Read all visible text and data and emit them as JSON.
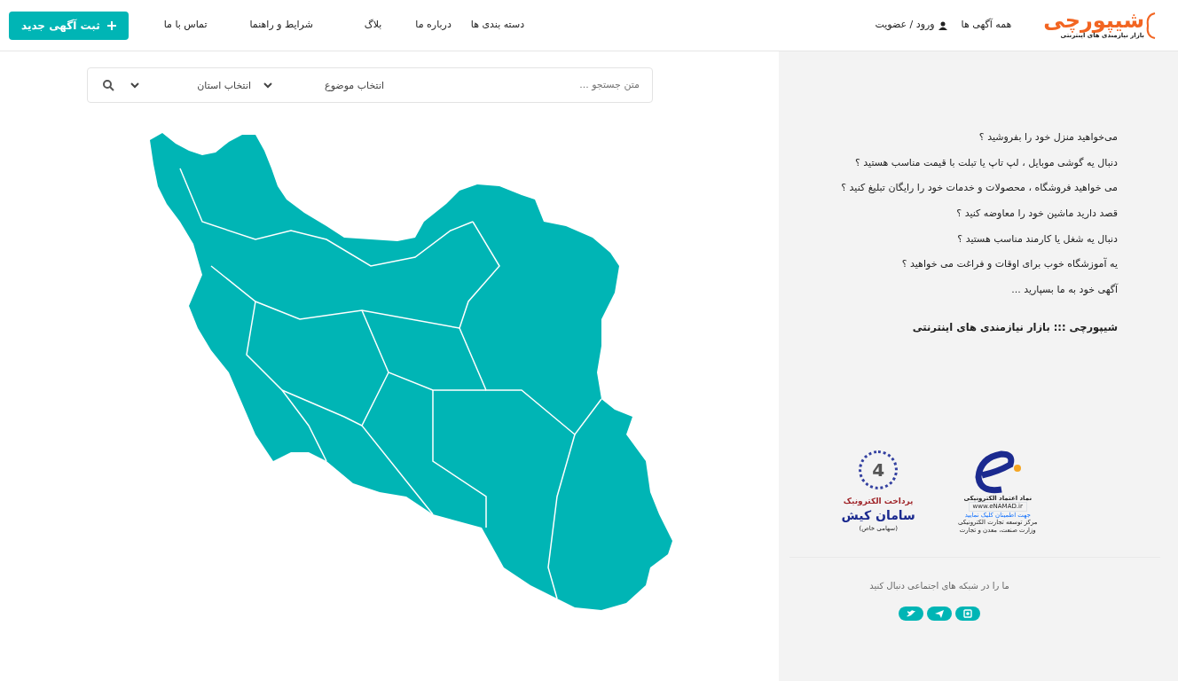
{
  "header": {
    "logo": {
      "title": "شیپورچی",
      "subtitle": "بازار نیازمندی های اینترنتی"
    },
    "all_ads": "همه آگهی ها",
    "login": "ورود / عضویت",
    "nav": [
      "دسته بندی ها",
      "درباره ما",
      "بلاگ",
      "شرایط و راهنما",
      "تماس با ما"
    ],
    "new_ad_button": "ثبت آگهی جدید"
  },
  "search": {
    "placeholder": "متن جستجو ...",
    "topic": "انتخاب موضوع",
    "province": "انتخاب استان"
  },
  "sidebar": {
    "questions": [
      "می‌خواهید منزل خود را بفروشید ؟",
      "دنبال یه گوشی موبایل ، لپ تاپ یا تبلت با قیمت مناسب هستید ؟",
      "می خواهید فروشگاه ، محصولات و خدمات خود را رایگان تبلیغ کنید ؟",
      "قصد دارید ماشین خود را معاوضه کنید ؟",
      "دنبال یه شغل یا کارمند مناسب هستید ؟",
      "یه آموزشگاه خوب برای اوقات و فراغت می خواهید ؟",
      "آگهی خود به ما بسپارید ..."
    ],
    "tagline": "شیپورچی ::: بازار نیازمندی های اینترنتی",
    "enamad": {
      "lines": [
        "نماد اعتماد الکترونیکی",
        "www.eNAMAD.ir",
        "جهت اطمینان کلیک نمایید",
        "مرکز توسعه تجارت الکترونیکی",
        "وزارت صنعت، معدن و تجارت"
      ]
    },
    "saman": {
      "number": "4",
      "caption": "پرداخت الکترونیک",
      "name": "سامان کیش",
      "note": "(سهامی خاص)"
    },
    "follow_text": "ما را در شبکه های اجتماعی دنبال کنید",
    "social": [
      {
        "kind": "instagram"
      },
      {
        "kind": "telegram"
      },
      {
        "kind": "twitter"
      }
    ]
  }
}
